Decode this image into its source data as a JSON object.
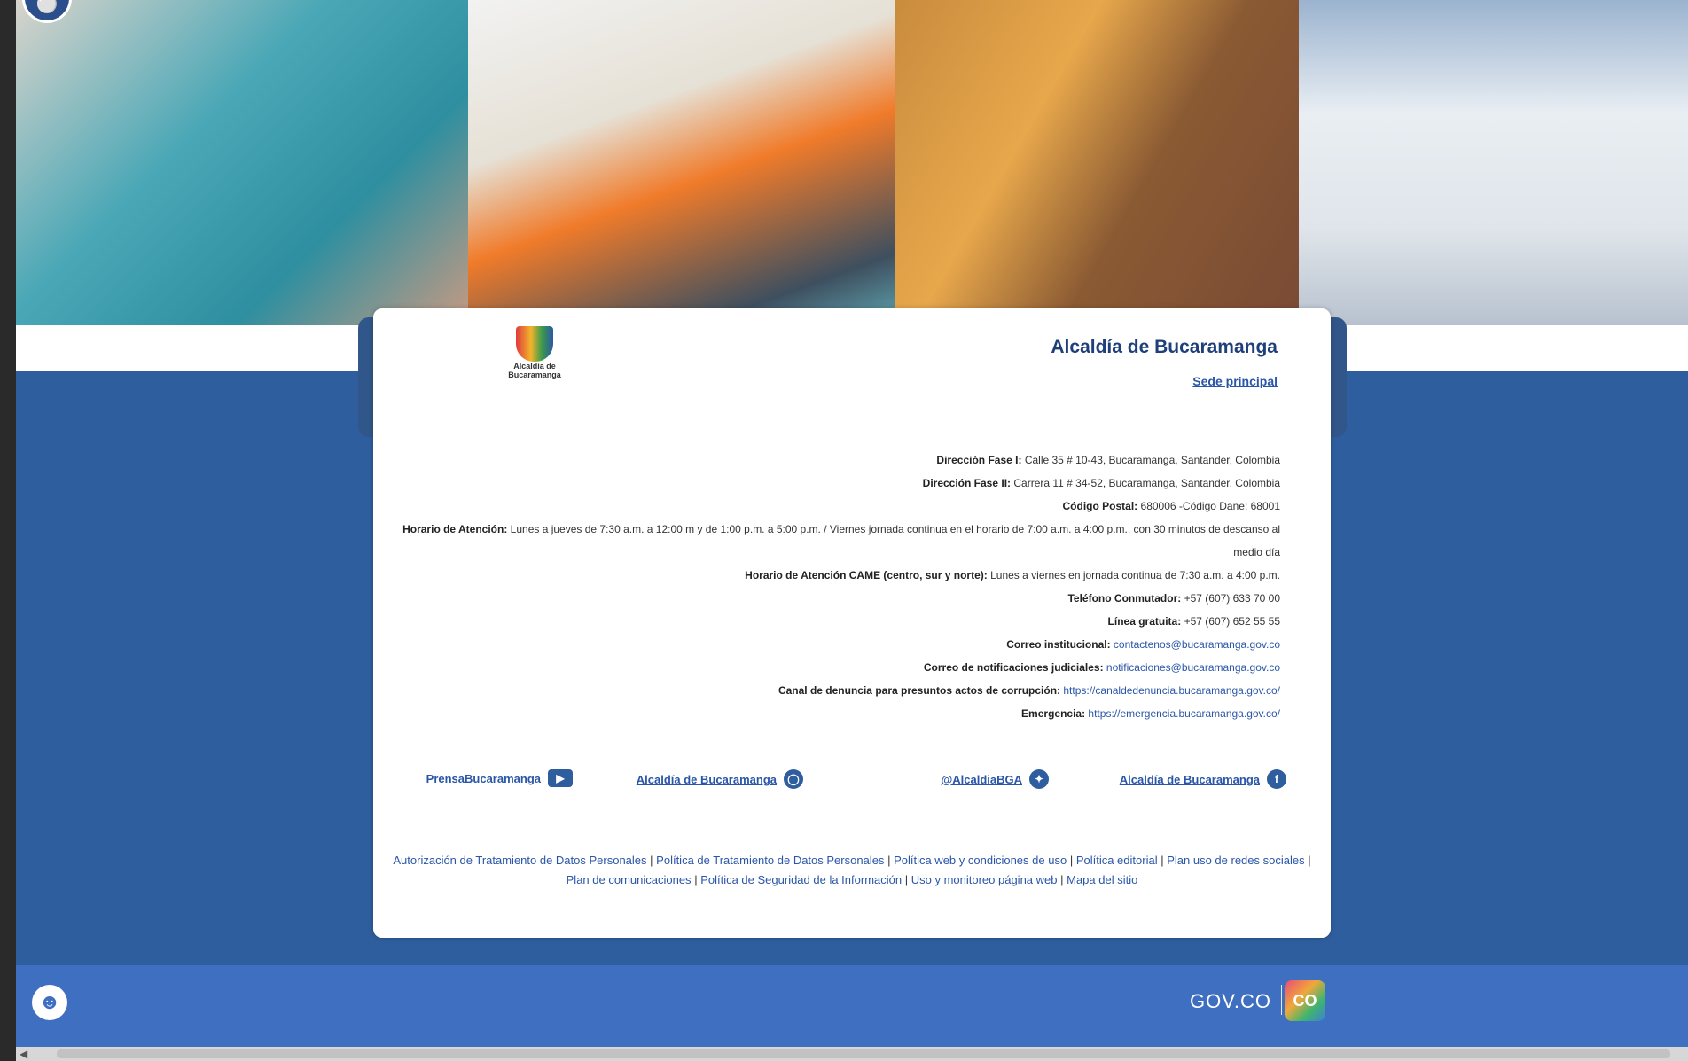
{
  "org": {
    "title": "Alcaldía de Bucaramanga",
    "sede_link": "Sede principal",
    "logo_text": "Alcaldía de Bucaramanga"
  },
  "info": {
    "dir1_label": "Dirección Fase I:",
    "dir1_value": "Calle 35 # 10-43, Bucaramanga, Santander, Colombia",
    "dir2_label": "Dirección Fase II:",
    "dir2_value": "Carrera 11 # 34-52, Bucaramanga, Santander, Colombia",
    "postal_label": "Código Postal:",
    "postal_value": "680006 -Código Dane: 68001",
    "horario_label": "Horario de Atención:",
    "horario_value": "Lunes a jueves de 7:30 a.m. a 12:00 m y de 1:00 p.m. a 5:00 p.m. / Viernes jornada continua en el horario de 7:00 a.m. a 4:00 p.m., con 30 minutos de descanso al medio día",
    "came_label": "Horario de Atención CAME (centro, sur y norte):",
    "came_value": "Lunes a viernes en jornada continua de 7:30 a.m. a 4:00 p.m.",
    "tel_label": "Teléfono Conmutador:",
    "tel_value": "+57 (607) 633 70 00",
    "linea_label": "Línea gratuita:",
    "linea_value": "+57 (607) 652 55 55",
    "correo_label": "Correo institucional:",
    "correo_value": "contactenos@bucaramanga.gov.co",
    "judicial_label": "Correo de notificaciones judiciales:",
    "judicial_value": "notificaciones@bucaramanga.gov.co",
    "denuncia_label": "Canal de denuncia para presuntos actos de corrupción:",
    "denuncia_value": "https://canaldedenuncia.bucaramanga.gov.co/",
    "emergencia_label": "Emergencia:",
    "emergencia_value": "https://emergencia.bucaramanga.gov.co/"
  },
  "social": [
    {
      "label": "Alcaldía de Bucaramanga",
      "icon": "facebook-icon"
    },
    {
      "label": "@AlcaldiaBGA",
      "icon": "twitter-icon"
    },
    {
      "label": "Alcaldía de Bucaramanga",
      "icon": "instagram-icon"
    },
    {
      "label": "PrensaBucaramanga",
      "icon": "youtube-icon"
    }
  ],
  "footer_links": [
    "Autorización de Tratamiento de Datos Personales",
    "Política de Tratamiento de Datos Personales",
    "Política web y condiciones de uso",
    "Política editorial",
    "Plan uso de redes sociales",
    "Plan de comunicaciones",
    "Política de Seguridad de la Información",
    "Uso y monitoreo página web",
    "Mapa del sitio"
  ],
  "govbar": {
    "co_label": "CO",
    "govco_label": "GOV.CO"
  },
  "colors": {
    "primary_blue": "#2f5e9e",
    "gov_blue": "#3f6fc1",
    "link_blue": "#2a56a8"
  }
}
